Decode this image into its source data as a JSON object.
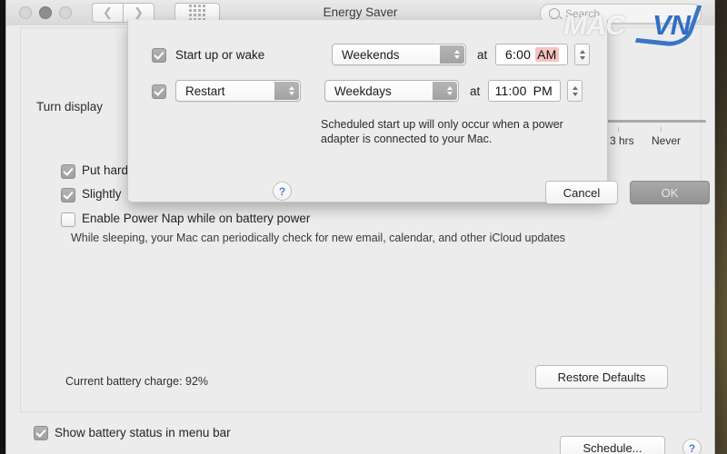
{
  "window": {
    "title": "Energy Saver",
    "traffic_lights": [
      "close",
      "minimize",
      "zoom"
    ],
    "nav": {
      "back_icon": "chevron-left-icon",
      "forward_icon": "chevron-right-icon",
      "show_all_icon": "grid-dots-icon"
    },
    "search": {
      "placeholder": "Search",
      "icon": "search-icon",
      "value": ""
    }
  },
  "watermark": {
    "part1": "MAC",
    "part2": "VN"
  },
  "main": {
    "display_sleep_label": "Turn display",
    "slider": {
      "tick_labels": [
        "3 hrs",
        "Never"
      ],
      "tick_positions_pct": [
        18,
        58
      ]
    },
    "options": [
      {
        "label": "Put hard",
        "checked": true
      },
      {
        "label": "Slightly",
        "checked": true
      },
      {
        "label": "Enable Power Nap while on battery power",
        "checked": false
      }
    ],
    "power_nap_note": "While sleeping, your Mac can periodically check for new email, calendar, and other iCloud updates",
    "battery_charge": "Current battery charge: 92%",
    "restore_defaults_label": "Restore Defaults"
  },
  "bottom_bar": {
    "show_battery_label": "Show battery status in menu bar",
    "show_battery_checked": true,
    "schedule_label": "Schedule...",
    "help_label": "?"
  },
  "sheet": {
    "row1": {
      "checked": true,
      "action_label": "Start up or wake",
      "when_value": "Weekends",
      "at_label": "at",
      "time_value": "6:00",
      "meridiem": "AM",
      "meridiem_selected": true
    },
    "row2": {
      "checked": true,
      "action_value": "Restart",
      "when_value": "Weekdays",
      "at_label": "at",
      "time_value": "11:00",
      "meridiem": "PM",
      "meridiem_selected": false
    },
    "note": "Scheduled start up will only occur when a power adapter is connected to your Mac.",
    "help_label": "?",
    "cancel_label": "Cancel",
    "ok_label": "OK"
  },
  "colors": {
    "window_bg": "#ececec",
    "accent_blue": "#2f6fc4",
    "selection_pink": "#f6c3be",
    "ok_button_gray": "#a0a0a0"
  }
}
